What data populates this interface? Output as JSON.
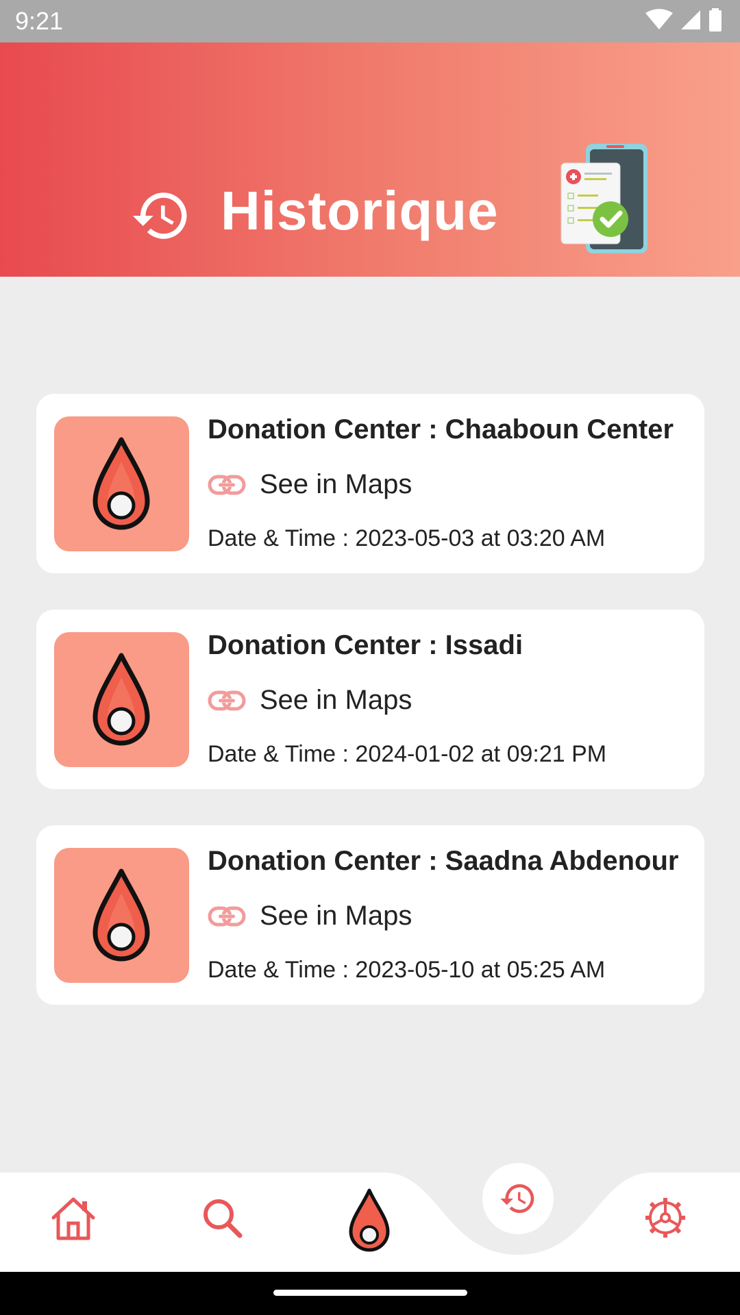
{
  "status_bar": {
    "time": "9:21"
  },
  "header": {
    "title": "Historique"
  },
  "cards": [
    {
      "title": "Donation Center : Chaaboun Center",
      "link_label": "See in Maps",
      "datetime": "Date & Time : 2023-05-03 at 03:20 AM"
    },
    {
      "title": "Donation Center : Issadi",
      "link_label": "See in Maps",
      "datetime": "Date & Time : 2024-01-02 at 09:21 PM"
    },
    {
      "title": "Donation Center : Saadna Abdenour",
      "link_label": "See in Maps",
      "datetime": "Date & Time : 2023-05-10 at 05:25 AM"
    }
  ],
  "bottom_nav": {
    "items": [
      "home-icon",
      "search-icon",
      "blood-drop-icon",
      "history-icon",
      "settings-icon"
    ],
    "active": "history-icon"
  },
  "colors": {
    "accent": "#e8585a",
    "thumb_bg": "#f99b86",
    "header_start": "#e84a4f",
    "header_end": "#f9a08a"
  }
}
